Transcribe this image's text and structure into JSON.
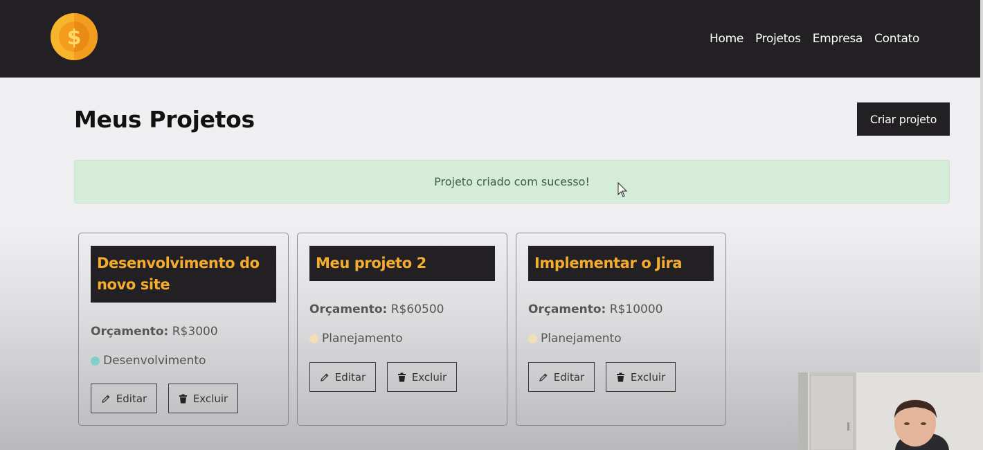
{
  "nav": {
    "logo_icon": "coin-dollar-icon",
    "links": [
      "Home",
      "Projetos",
      "Empresa",
      "Contato"
    ]
  },
  "page": {
    "title": "Meus Projetos",
    "create_button": "Criar projeto"
  },
  "alert": {
    "message": "Projeto criado com sucesso!"
  },
  "projects": [
    {
      "title": "Desenvolvimento do novo site",
      "budget_label": "Orçamento:",
      "budget_value": "R$3000",
      "category": "Desenvolvimento",
      "category_color": "#7fd1c8",
      "edit_label": "Editar",
      "delete_label": "Excluir"
    },
    {
      "title": "Meu projeto 2",
      "budget_label": "Orçamento:",
      "budget_value": "R$60500",
      "category": "Planejamento",
      "category_color": "#f3dfb7",
      "edit_label": "Editar",
      "delete_label": "Excluir"
    },
    {
      "title": "Implementar o Jira",
      "budget_label": "Orçamento:",
      "budget_value": "R$10000",
      "category": "Planejamento",
      "category_color": "#f3dfb7",
      "edit_label": "Editar",
      "delete_label": "Excluir"
    }
  ],
  "colors": {
    "navbar": "#222022",
    "card_title_text": "#f5ad30",
    "alert_bg": "#d5ecd8"
  }
}
